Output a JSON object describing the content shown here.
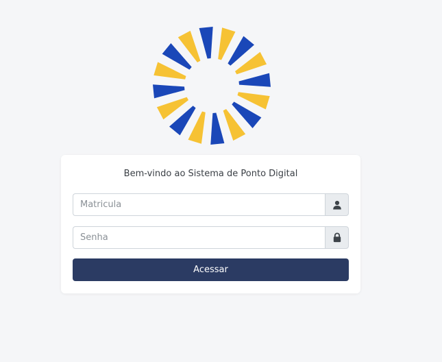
{
  "logo": {
    "icon": "sunburst-logo",
    "colors": {
      "blue": "#1a47b8",
      "yellow": "#f6c234"
    }
  },
  "login": {
    "welcome": "Bem-vindo ao Sistema de Ponto Digital",
    "matricula_placeholder": "Matricula",
    "matricula_icon": "user-icon",
    "senha_placeholder": "Senha",
    "senha_icon": "lock-icon",
    "submit_label": "Acessar"
  },
  "colors": {
    "background": "#f5f6f8",
    "button": "#2b3b63",
    "addon": "#e9ecef"
  }
}
